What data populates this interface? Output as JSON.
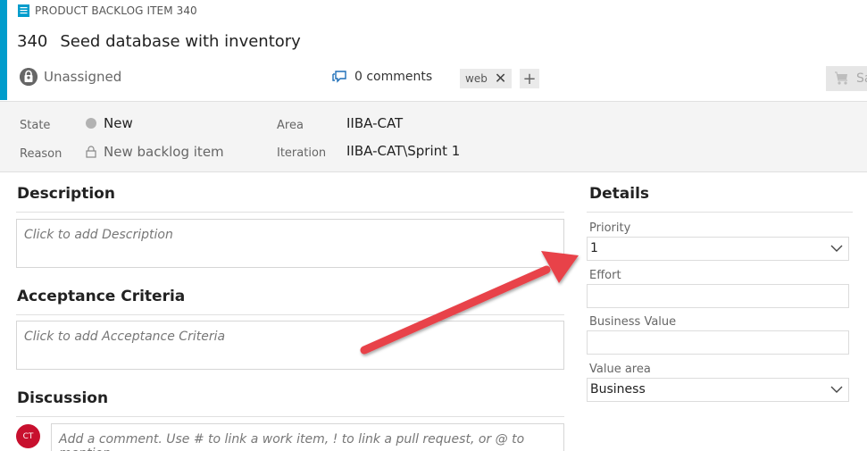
{
  "header": {
    "work_item_type": "PRODUCT BACKLOG ITEM 340",
    "id": "340",
    "title": "Seed database with inventory",
    "assignee": "Unassigned",
    "comments": "0 comments",
    "tags": [
      "web"
    ],
    "save_label": "Save"
  },
  "fields": {
    "state_label": "State",
    "state_value": "New",
    "reason_label": "Reason",
    "reason_value": "New backlog item",
    "area_label": "Area",
    "area_value": "IIBA-CAT",
    "iteration_label": "Iteration",
    "iteration_value": "IIBA-CAT\\Sprint 1"
  },
  "main": {
    "description_title": "Description",
    "description_placeholder": "Click to add Description",
    "acceptance_title": "Acceptance Criteria",
    "acceptance_placeholder": "Click to add Acceptance Criteria",
    "discussion_title": "Discussion",
    "comment_avatar_initials": "CT",
    "comment_placeholder": "Add a comment. Use # to link a work item, ! to link a pull request, or @ to mention"
  },
  "details": {
    "title": "Details",
    "priority_label": "Priority",
    "priority_value": "1",
    "effort_label": "Effort",
    "effort_value": "",
    "business_value_label": "Business Value",
    "business_value_value": "",
    "value_area_label": "Value area",
    "value_area_value": "Business"
  },
  "colors": {
    "accent": "#009ccc",
    "annotation_arrow": "#e8424a",
    "avatar_red": "#c8102e"
  }
}
